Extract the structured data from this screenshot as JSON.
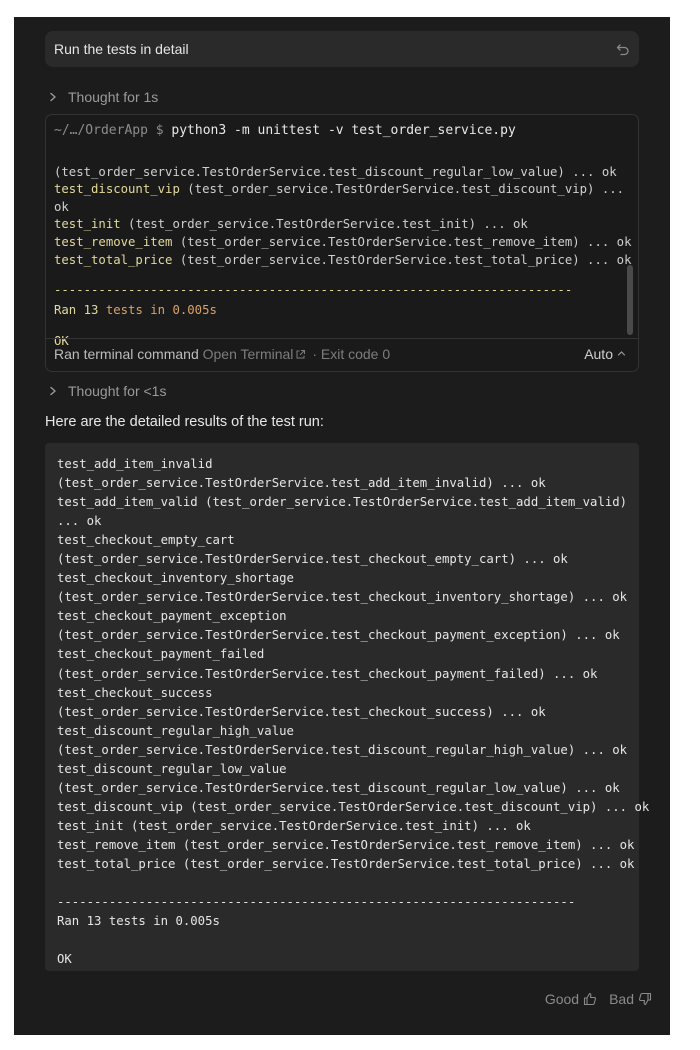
{
  "prompt": {
    "text": "Run the tests in detail",
    "icon": "undo-icon"
  },
  "thought1": {
    "label": "Thought for 1s"
  },
  "terminal": {
    "cwd": "~/…/OrderApp $",
    "command": "python3 -m unittest -v test_order_service.py",
    "lines": [
      {
        "name": "",
        "rest": "(test_order_service.TestOrderService.test_discount_regular_low_value) ... ok"
      },
      {
        "name": "test_discount_vip",
        "rest": " (test_order_service.TestOrderService.test_discount_vip) ..."
      },
      {
        "name": "",
        "rest": "ok"
      },
      {
        "name": "test_init",
        "rest": " (test_order_service.TestOrderService.test_init) ... ok"
      },
      {
        "name": "test_remove_item",
        "rest": " (test_order_service.TestOrderService.test_remove_item) ... ok"
      },
      {
        "name": "test_total_price",
        "rest": " (test_order_service.TestOrderService.test_total_price) ... ok"
      }
    ],
    "separator": "----------------------------------------------------------------------",
    "ran_prefix": "Ran 13",
    "ran_suffix": " tests in 0.005s",
    "ok": "OK",
    "footer_label": "Ran terminal command",
    "open_terminal": "Open Terminal",
    "exit_code": "· Exit code 0",
    "mode": "Auto"
  },
  "thought2": {
    "label": "Thought for <1s"
  },
  "summary": "Here are the detailed results of the test run:",
  "results": "test_add_item_invalid\n(test_order_service.TestOrderService.test_add_item_invalid) ... ok\ntest_add_item_valid (test_order_service.TestOrderService.test_add_item_valid)\n... ok\ntest_checkout_empty_cart\n(test_order_service.TestOrderService.test_checkout_empty_cart) ... ok\ntest_checkout_inventory_shortage\n(test_order_service.TestOrderService.test_checkout_inventory_shortage) ... ok\ntest_checkout_payment_exception\n(test_order_service.TestOrderService.test_checkout_payment_exception) ... ok\ntest_checkout_payment_failed\n(test_order_service.TestOrderService.test_checkout_payment_failed) ... ok\ntest_checkout_success\n(test_order_service.TestOrderService.test_checkout_success) ... ok\ntest_discount_regular_high_value\n(test_order_service.TestOrderService.test_discount_regular_high_value) ... ok\ntest_discount_regular_low_value\n(test_order_service.TestOrderService.test_discount_regular_low_value) ... ok\ntest_discount_vip (test_order_service.TestOrderService.test_discount_vip) ... ok\ntest_init (test_order_service.TestOrderService.test_init) ... ok\ntest_remove_item (test_order_service.TestOrderService.test_remove_item) ... ok\ntest_total_price (test_order_service.TestOrderService.test_total_price) ... ok\n\n----------------------------------------------------------------------\nRan 13 tests in 0.005s\n\nOK",
  "feedback": {
    "good": "Good",
    "bad": "Bad"
  }
}
